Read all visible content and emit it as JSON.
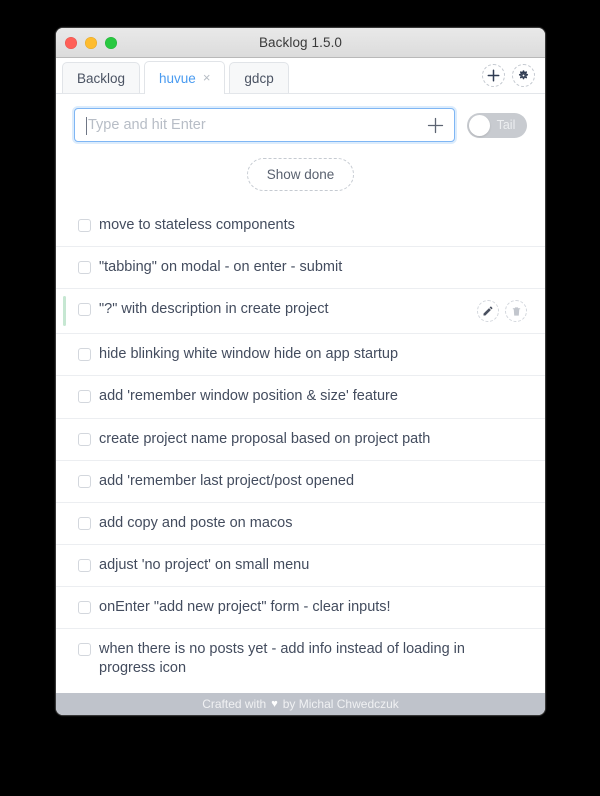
{
  "window": {
    "title": "Backlog 1.5.0",
    "traffic_lights": [
      {
        "name": "close",
        "color": "#ff5f57"
      },
      {
        "name": "minimize",
        "color": "#febc2e"
      },
      {
        "name": "maximize",
        "color": "#28c840"
      }
    ]
  },
  "tabs": [
    {
      "label": "Backlog",
      "active": false,
      "closable": false
    },
    {
      "label": "huvue",
      "active": true,
      "closable": true,
      "close_glyph": "×"
    },
    {
      "label": "gdcp",
      "active": false,
      "closable": false
    }
  ],
  "tab_actions": [
    {
      "name": "add-project-icon",
      "label": "+"
    },
    {
      "name": "settings-gear-icon",
      "label": "⚙"
    }
  ],
  "add_bar": {
    "placeholder": "Type and hit Enter",
    "value": "",
    "submit_icon": "plus-icon",
    "focused": true
  },
  "tail_toggle": {
    "label": "Tail",
    "state": "off"
  },
  "show_done_button": {
    "label": "Show done"
  },
  "tasks": [
    {
      "text": "move to stateless components",
      "done": false,
      "hovered": false
    },
    {
      "text": "\"tabbing\" on modal - on enter - submit",
      "done": false,
      "hovered": false
    },
    {
      "text": "\"?\" with description in create project",
      "done": false,
      "hovered": true
    },
    {
      "text": "hide blinking white window hide on app startup",
      "done": false,
      "hovered": false
    },
    {
      "text": "add 'remember window position & size' feature",
      "done": false,
      "hovered": false
    },
    {
      "text": "create project name proposal based on project path",
      "done": false,
      "hovered": false
    },
    {
      "text": "add 'remember last project/post opened",
      "done": false,
      "hovered": false
    },
    {
      "text": "add copy and poste on macos",
      "done": false,
      "hovered": false
    },
    {
      "text": "adjust 'no project' on small menu",
      "done": false,
      "hovered": false
    },
    {
      "text": "onEnter \"add new project\" form - clear inputs!",
      "done": false,
      "hovered": false
    },
    {
      "text": "when there is no posts yet - add info instead of loading in progress icon",
      "done": false,
      "hovered": false
    }
  ],
  "row_actions": {
    "edit_label": "edit-pencil-icon",
    "delete_label": "trash-icon"
  },
  "footer": {
    "prefix": "Crafted with",
    "heart": "♥",
    "suffix": "by Michal Chwedczuk"
  },
  "colors": {
    "accent_blue": "#4a9bf0",
    "focus_border": "#7fb6f4",
    "hover_bar_green": "#c6e7d2",
    "footer_bg": "#bfc3cb",
    "text": "#434c5e"
  }
}
